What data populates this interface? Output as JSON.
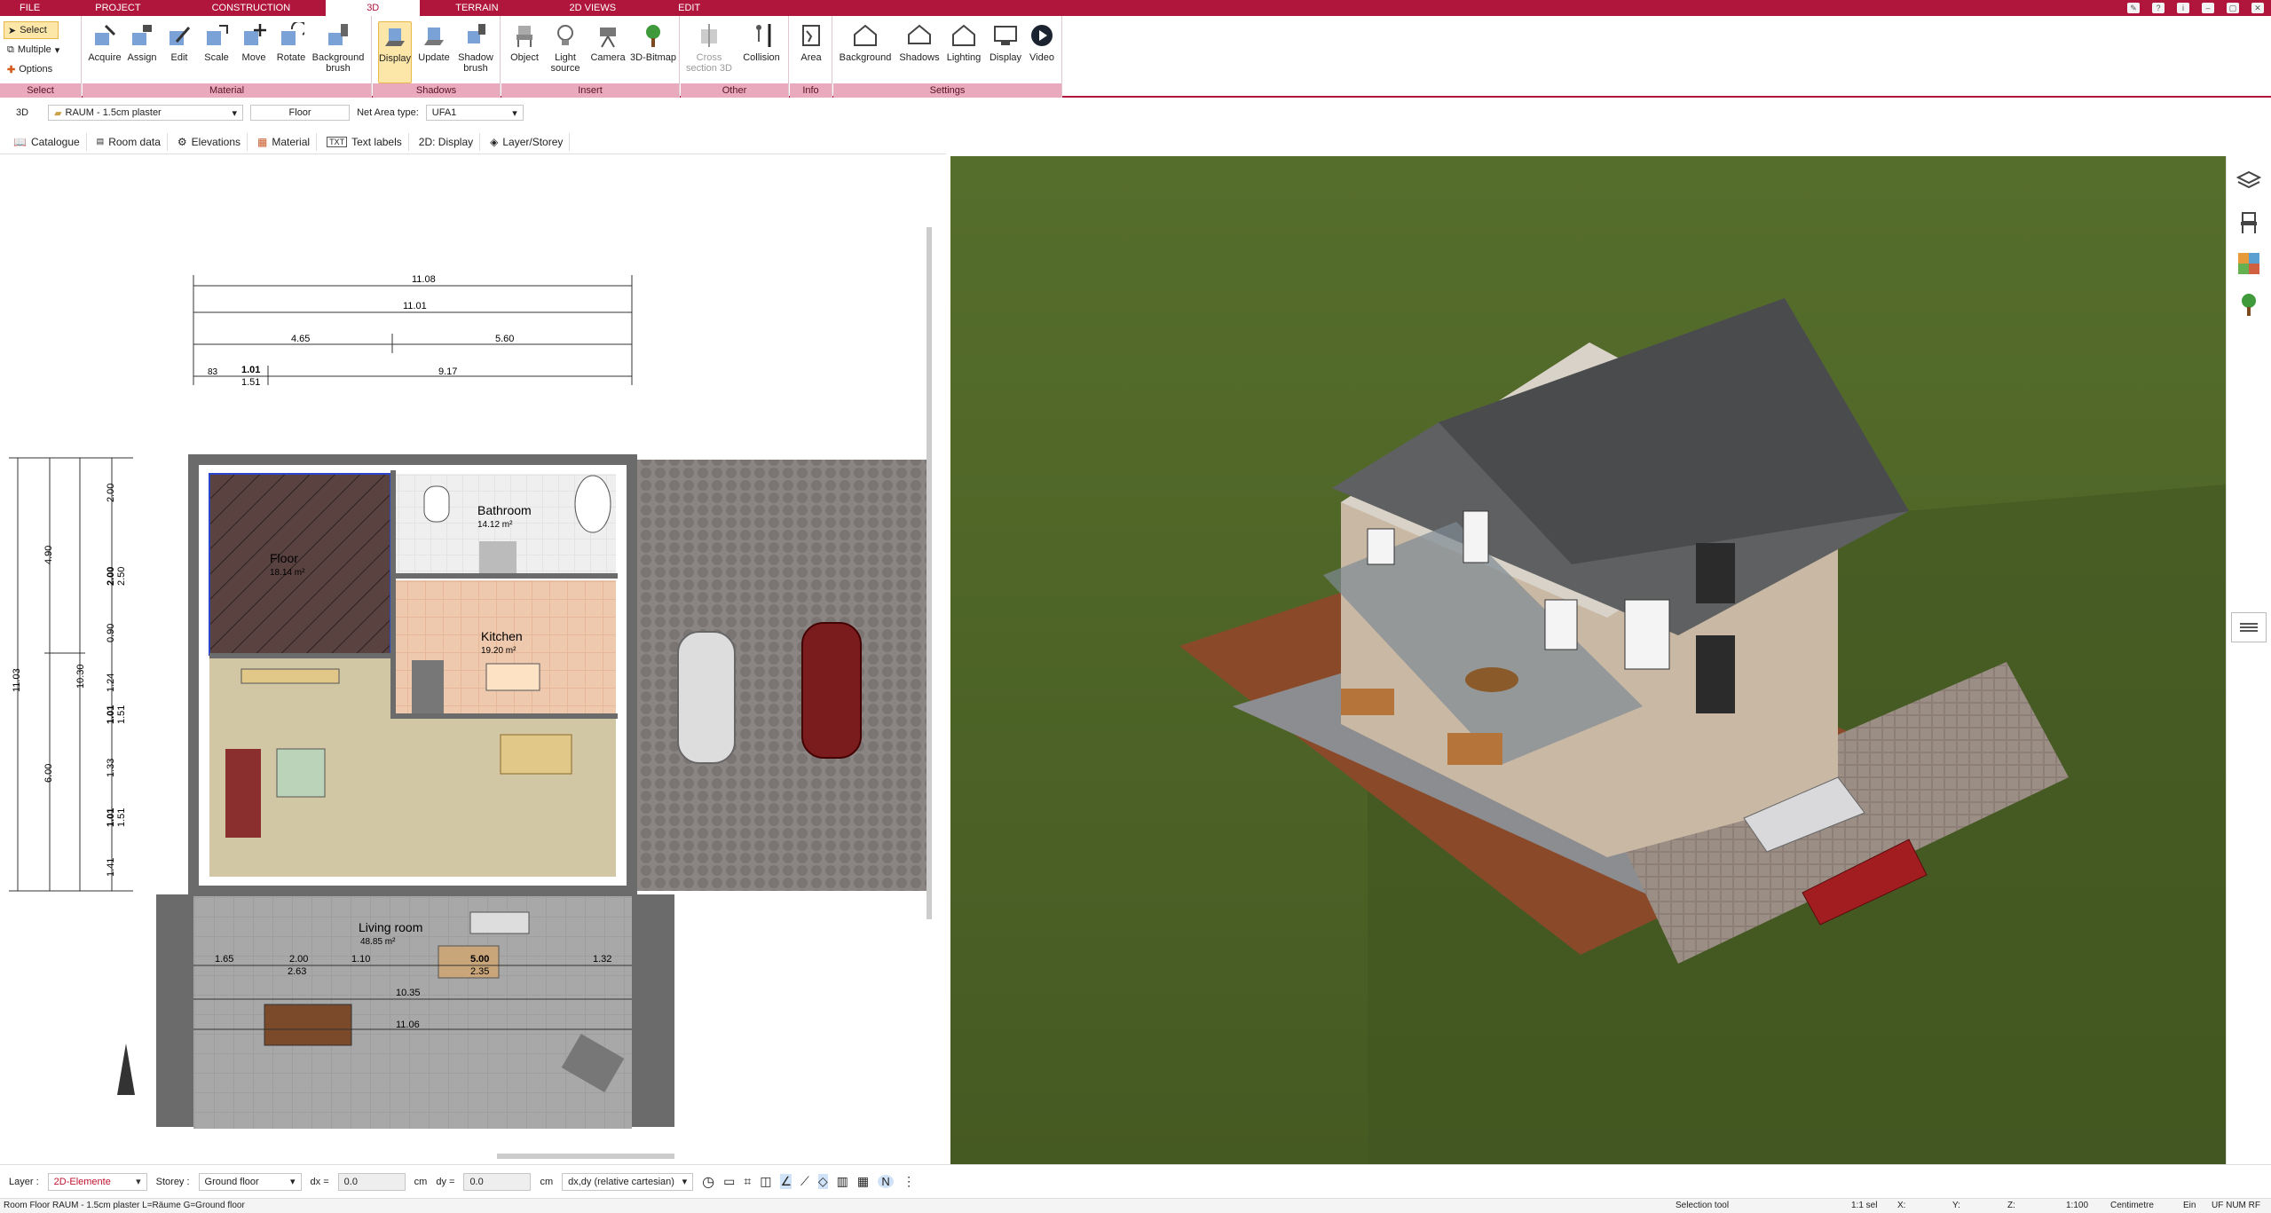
{
  "tabs": [
    "FILE",
    "PROJECT",
    "CONSTRUCTION",
    "3D",
    "TERRAIN",
    "2D VIEWS",
    "EDIT"
  ],
  "select_group": {
    "select": "Select",
    "multiple": "Multiple",
    "options": "Options",
    "label": "Select"
  },
  "material_group": {
    "label": "Material",
    "buttons": [
      "Acquire",
      "Assign",
      "Edit",
      "Scale",
      "Move",
      "Rotate",
      "Background brush"
    ]
  },
  "shadows_group": {
    "label": "Shadows",
    "buttons": [
      "Display",
      "Update",
      "Shadow brush"
    ]
  },
  "insert_group": {
    "label": "Insert",
    "buttons": [
      "Object",
      "Light source",
      "Camera",
      "3D-Bitmap"
    ]
  },
  "other_group": {
    "label": "Other",
    "buttons": [
      "Cross section 3D",
      "Collision"
    ]
  },
  "info_group": {
    "label": "Info",
    "buttons": [
      "Area"
    ]
  },
  "settings_group": {
    "label": "Settings",
    "buttons": [
      "Background",
      "Shadows",
      "Lighting",
      "Display",
      "Video"
    ]
  },
  "propbar": {
    "mode": "3D",
    "material": "RAUM - 1.5cm plaster",
    "room_name": "Floor",
    "net_area_label": "Net Area type:",
    "net_area_value": "UFA1"
  },
  "toolbar2": [
    "Catalogue",
    "Room data",
    "Elevations",
    "Material",
    "Text labels",
    "2D: Display",
    "Layer/Storey"
  ],
  "plan": {
    "dims_top": [
      "11.08",
      "11.01",
      "4.65",
      "5.60",
      "1.01",
      "1.51",
      "9.17",
      "83"
    ],
    "dims_left": [
      "2.00",
      "4.90",
      "2.00",
      "2.50",
      "0.90",
      "10.30",
      "11.03",
      "1.01",
      "1.51",
      "6.00",
      "1.33",
      "1.01",
      "1.51",
      "1.41",
      "1.24"
    ],
    "rooms": [
      {
        "name": "Floor",
        "area": "18.14 m²"
      },
      {
        "name": "Bathroom",
        "area": "14.12 m²"
      },
      {
        "name": "Kitchen",
        "area": "19.20 m²"
      },
      {
        "name": "Living room",
        "area": "48.85 m²"
      }
    ],
    "terrace_dims": [
      "1.65",
      "2.00",
      "2.63",
      "1.10",
      "5.00",
      "2.35",
      "1.32",
      "10.35",
      "11.06"
    ]
  },
  "statusbar": {
    "layer_label": "Layer :",
    "layer_value": "2D-Elemente",
    "storey_label": "Storey :",
    "storey_value": "Ground floor",
    "dx_label": "dx =",
    "dx_value": "0.0",
    "dy_label": "dy =",
    "dy_value": "0.0",
    "unit": "cm",
    "coord_mode": "dx,dy (relative cartesian)"
  },
  "bottombar": {
    "info": "Room Floor RAUM - 1.5cm plaster L=Räume G=Ground floor",
    "tool": "Selection tool",
    "sel": "1:1 sel",
    "x": "X:",
    "y": "Y:",
    "z": "Z:",
    "scale": "1:100",
    "unit": "Centimetre",
    "ein": "Ein",
    "flags": "UF NUM RF"
  }
}
